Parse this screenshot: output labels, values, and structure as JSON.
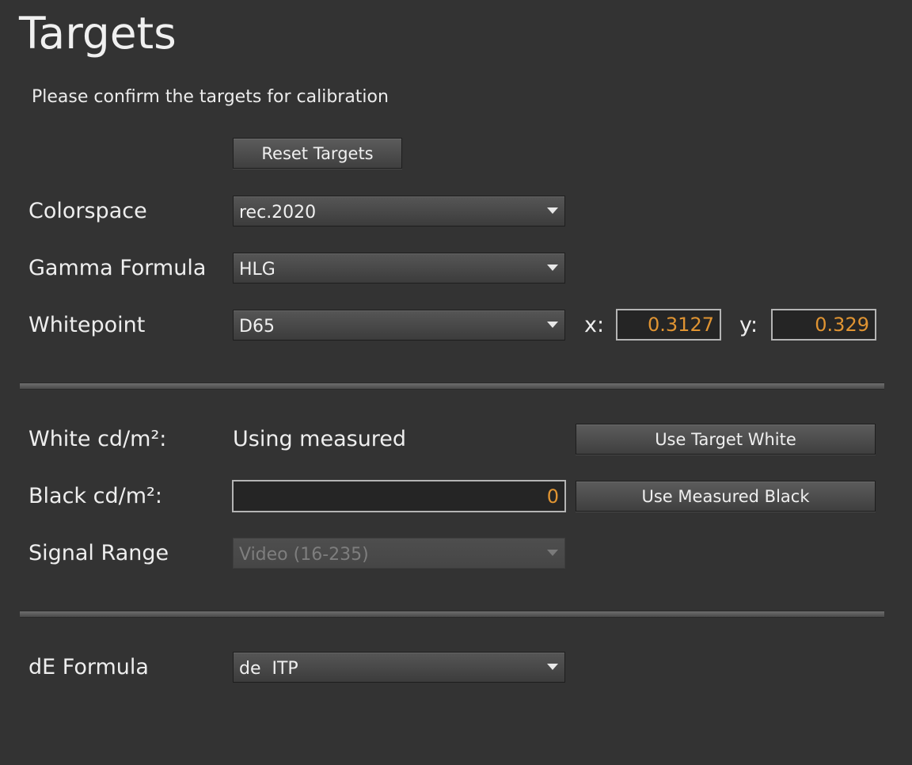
{
  "page": {
    "title": "Targets",
    "subtitle": "Please confirm the targets for calibration"
  },
  "reset_button": {
    "label": "Reset Targets"
  },
  "colorspace": {
    "label": "Colorspace",
    "selected": "rec.2020"
  },
  "gamma": {
    "label": "Gamma Formula",
    "selected": "HLG"
  },
  "whitepoint": {
    "label": "Whitepoint",
    "selected": "D65",
    "x_label": "x:",
    "x_value": "0.3127",
    "y_label": "y:",
    "y_value": "0.329"
  },
  "white": {
    "label": "White cd/m²:",
    "status": "Using measured",
    "button_label": "Use Target White"
  },
  "black": {
    "label": "Black cd/m²:",
    "value": "0",
    "button_label": "Use Measured Black"
  },
  "signal_range": {
    "label": "Signal Range",
    "selected": "Video (16-235)",
    "disabled": true
  },
  "de_formula": {
    "label": "dE Formula",
    "selected": "de  ITP"
  },
  "colors": {
    "background": "#333333",
    "value_accent": "#e09432",
    "text": "#eeeeee"
  },
  "icons": {
    "dropdown": "triangle-down-icon"
  }
}
